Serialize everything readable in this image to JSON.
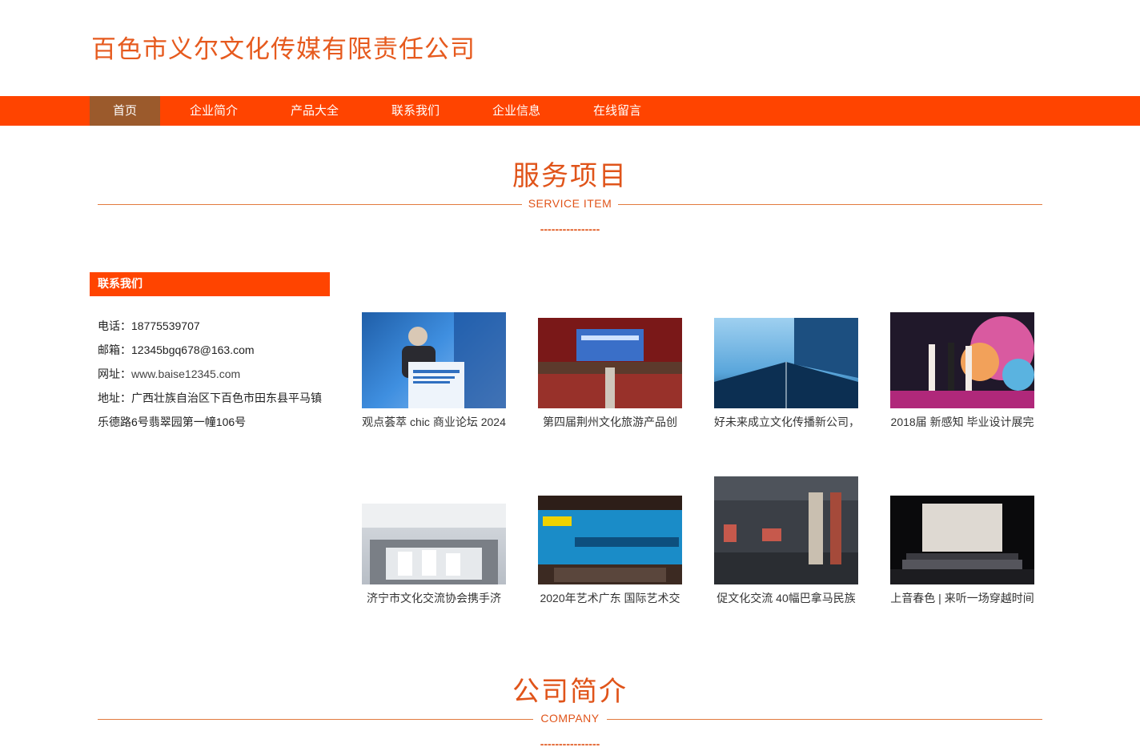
{
  "site": {
    "title": "百色市义尔文化传媒有限责任公司"
  },
  "nav": {
    "items": [
      {
        "label": "首页"
      },
      {
        "label": "企业简介"
      },
      {
        "label": "产品大全"
      },
      {
        "label": "联系我们"
      },
      {
        "label": "企业信息"
      },
      {
        "label": "在线留言"
      }
    ],
    "active_index": 0
  },
  "service": {
    "title": "服务项目",
    "subtitle": "SERVICE ITEM",
    "dashes": "----------------"
  },
  "contact": {
    "heading": "联系我们",
    "phone_label": "电话：",
    "phone": "18775539707",
    "email_label": "邮箱：",
    "email": "12345bgq678@163.com",
    "site_label": "网址：",
    "site": "www.baise12345.com",
    "address_label": "地址：",
    "address_line1": "广西壮族自治区下百色市田东县平马镇",
    "address_line2": "乐德路6号翡翠园第一幢106号"
  },
  "products": [
    {
      "caption": "观点荟萃 chic 商业论坛 2024"
    },
    {
      "caption": "第四届荆州文化旅游产品创"
    },
    {
      "caption": "好未来成立文化传播新公司，"
    },
    {
      "caption": "2018届 新感知 毕业设计展完"
    },
    {
      "caption": "济宁市文化交流协会携手济"
    },
    {
      "caption": "2020年艺术广东 国际艺术交"
    },
    {
      "caption": "促文化交流 40幅巴拿马民族"
    },
    {
      "caption": "上音春色 | 来听一场穿越时间"
    }
  ],
  "company": {
    "title": "公司简介",
    "subtitle": "COMPANY",
    "dashes": "----------------"
  },
  "colors": {
    "accent": "#ff4400",
    "active_nav": "#9b5a2c",
    "title": "#e65a1e"
  }
}
